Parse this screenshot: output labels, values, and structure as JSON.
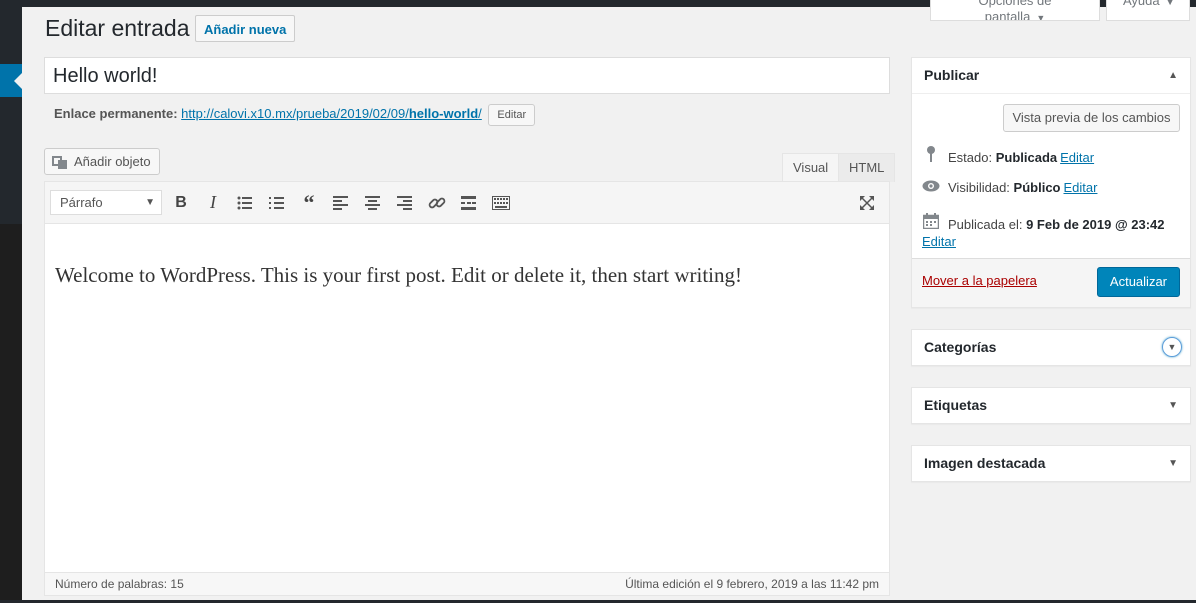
{
  "top": {
    "screen_options": "Opciones de pantalla",
    "help": "Ayuda"
  },
  "header": {
    "title": "Editar entrada",
    "add_new": "Añadir nueva"
  },
  "post": {
    "title": "Hello world!",
    "permalink_label": "Enlace permanente:",
    "permalink_url_base": "http://calovi.x10.mx/prueba/2019/02/09/",
    "permalink_slug": "hello-world",
    "permalink_url_tail": "/",
    "permalink_edit": "Editar"
  },
  "editor": {
    "add_media": "Añadir objeto",
    "tab_visual": "Visual",
    "tab_html": "HTML",
    "format": "Párrafo",
    "content": "Welcome to WordPress. This is your first post. Edit or delete it, then start writing!",
    "word_count": "Número de palabras: 15",
    "last_edit": "Última edición el 9 febrero, 2019 a las 11:42 pm",
    "toolbar_icons": [
      "bold-icon",
      "italic-icon",
      "bullet-list-icon",
      "numbered-list-icon",
      "blockquote-icon",
      "align-left-icon",
      "align-center-icon",
      "align-right-icon",
      "link-icon",
      "read-more-icon",
      "toolbar-toggle-icon",
      "fullscreen-icon"
    ]
  },
  "publish": {
    "title": "Publicar",
    "preview": "Vista previa de los cambios",
    "status_label": "Estado:",
    "status_value": "Publicada",
    "visibility_label": "Visibilidad:",
    "visibility_value": "Público",
    "published_label": "Publicada el:",
    "published_value": "9 Feb de 2019 @ 23:42",
    "edit": "Editar",
    "trash": "Mover a la papelera",
    "update": "Actualizar"
  },
  "boxes": {
    "categories": "Categorías",
    "tags": "Etiquetas",
    "featured_image": "Imagen destacada"
  },
  "colors": {
    "accent": "#0073aa",
    "primary_button": "#0085ba",
    "trash": "#a00",
    "admin_bar": "#23282d"
  }
}
